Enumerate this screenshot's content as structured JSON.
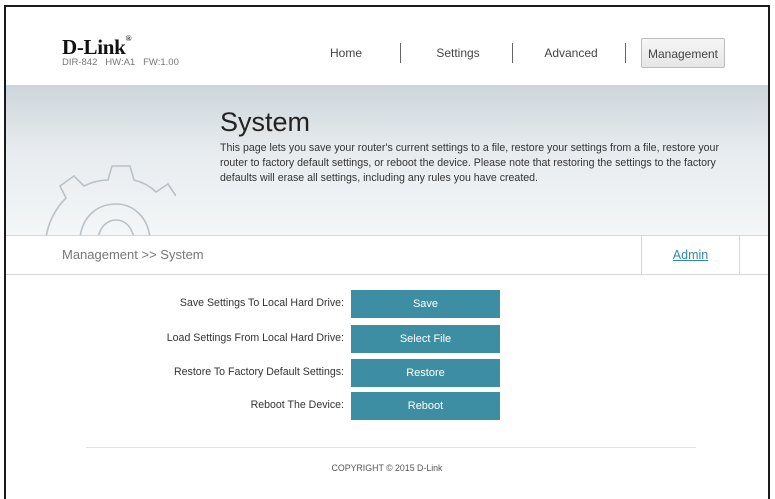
{
  "header": {
    "brand": "D-Link",
    "brand_mark": "®",
    "model_info": "DIR-842   HW:A1   FW:1.00"
  },
  "nav": {
    "items": [
      {
        "label": "Home"
      },
      {
        "label": "Settings"
      },
      {
        "label": "Advanced"
      },
      {
        "label": "Management"
      }
    ],
    "active": "Management"
  },
  "banner": {
    "title": "System",
    "description": "This page lets you save your router's current settings to a file, restore your settings from a file, restore your router to factory default settings, or reboot the device. Please note that restoring the settings to the factory defaults will erase all settings, including any rules you have created.",
    "icon": "gear-icon"
  },
  "breadcrumb": {
    "path": "Management >> System",
    "tab_label": "Admin"
  },
  "actions": [
    {
      "label": "Save Settings To Local Hard Drive:",
      "button": "Save"
    },
    {
      "label": "Load Settings From Local Hard Drive:",
      "button": "Select File"
    },
    {
      "label": "Restore To Factory Default Settings:",
      "button": "Restore"
    },
    {
      "label": "Reboot The Device:",
      "button": "Reboot"
    }
  ],
  "footer": {
    "copyright": "COPYRIGHT © 2015 D-Link"
  },
  "colors": {
    "accent": "#3d8ea2",
    "link": "#2f8ba3"
  }
}
